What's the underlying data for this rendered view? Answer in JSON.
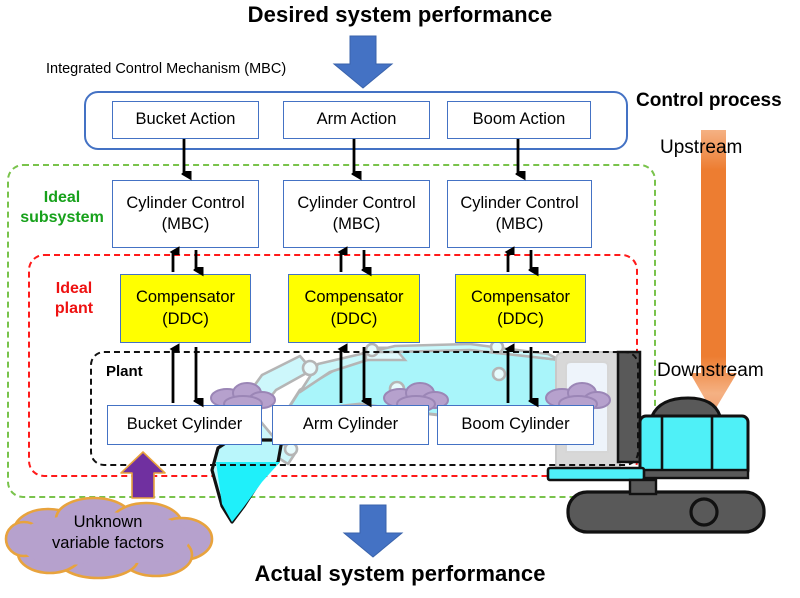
{
  "header": {
    "top_title": "Desired system performance",
    "bottom_title": "Actual system performance",
    "mechanism_label": "Integrated Control Mechanism (MBC)",
    "control_process_label": "Control process",
    "upstream_label": "Upstream",
    "downstream_label": "Downstream"
  },
  "groups": {
    "ideal_subsystem": "Ideal\nsubsystem",
    "ideal_subsystem_line1": "Ideal",
    "ideal_subsystem_line2": "subsystem",
    "ideal_plant_line1": "Ideal",
    "ideal_plant_line2": "plant",
    "plant_label": "Plant"
  },
  "rows": {
    "action": [
      {
        "label": "Bucket Action"
      },
      {
        "label": "Arm Action"
      },
      {
        "label": "Boom Action"
      }
    ],
    "cylinder_control": [
      {
        "line1": "Cylinder Control",
        "line2": "(MBC)"
      },
      {
        "line1": "Cylinder Control",
        "line2": "(MBC)"
      },
      {
        "line1": "Cylinder Control",
        "line2": "(MBC)"
      }
    ],
    "compensator": [
      {
        "line1": "Compensator",
        "line2": "(DDC)"
      },
      {
        "line1": "Compensator",
        "line2": "(DDC)"
      },
      {
        "line1": "Compensator",
        "line2": "(DDC)"
      }
    ],
    "cylinder": [
      {
        "label": "Bucket Cylinder"
      },
      {
        "label": "Arm Cylinder"
      },
      {
        "label": "Boom Cylinder"
      }
    ]
  },
  "cloud": {
    "line1": "Unknown",
    "line2": "variable factors"
  },
  "colors": {
    "blue_arrow": "#4472c4",
    "orange_arrow": "#ed7d31",
    "green_dashed": "#79c34b",
    "red_dashed": "#ff1a1a",
    "yellow_box": "#ffff00",
    "box_border": "#4472c4",
    "cloud_fill": "#b6a1cd",
    "cloud_stroke": "#e8a33d",
    "purple_arrow": "#7030a0",
    "excavator_cyan": "#5ff0f5",
    "excavator_gray": "#595959",
    "ideal_subsystem_text": "#17a11b",
    "ideal_plant_text": "#ee1111"
  }
}
